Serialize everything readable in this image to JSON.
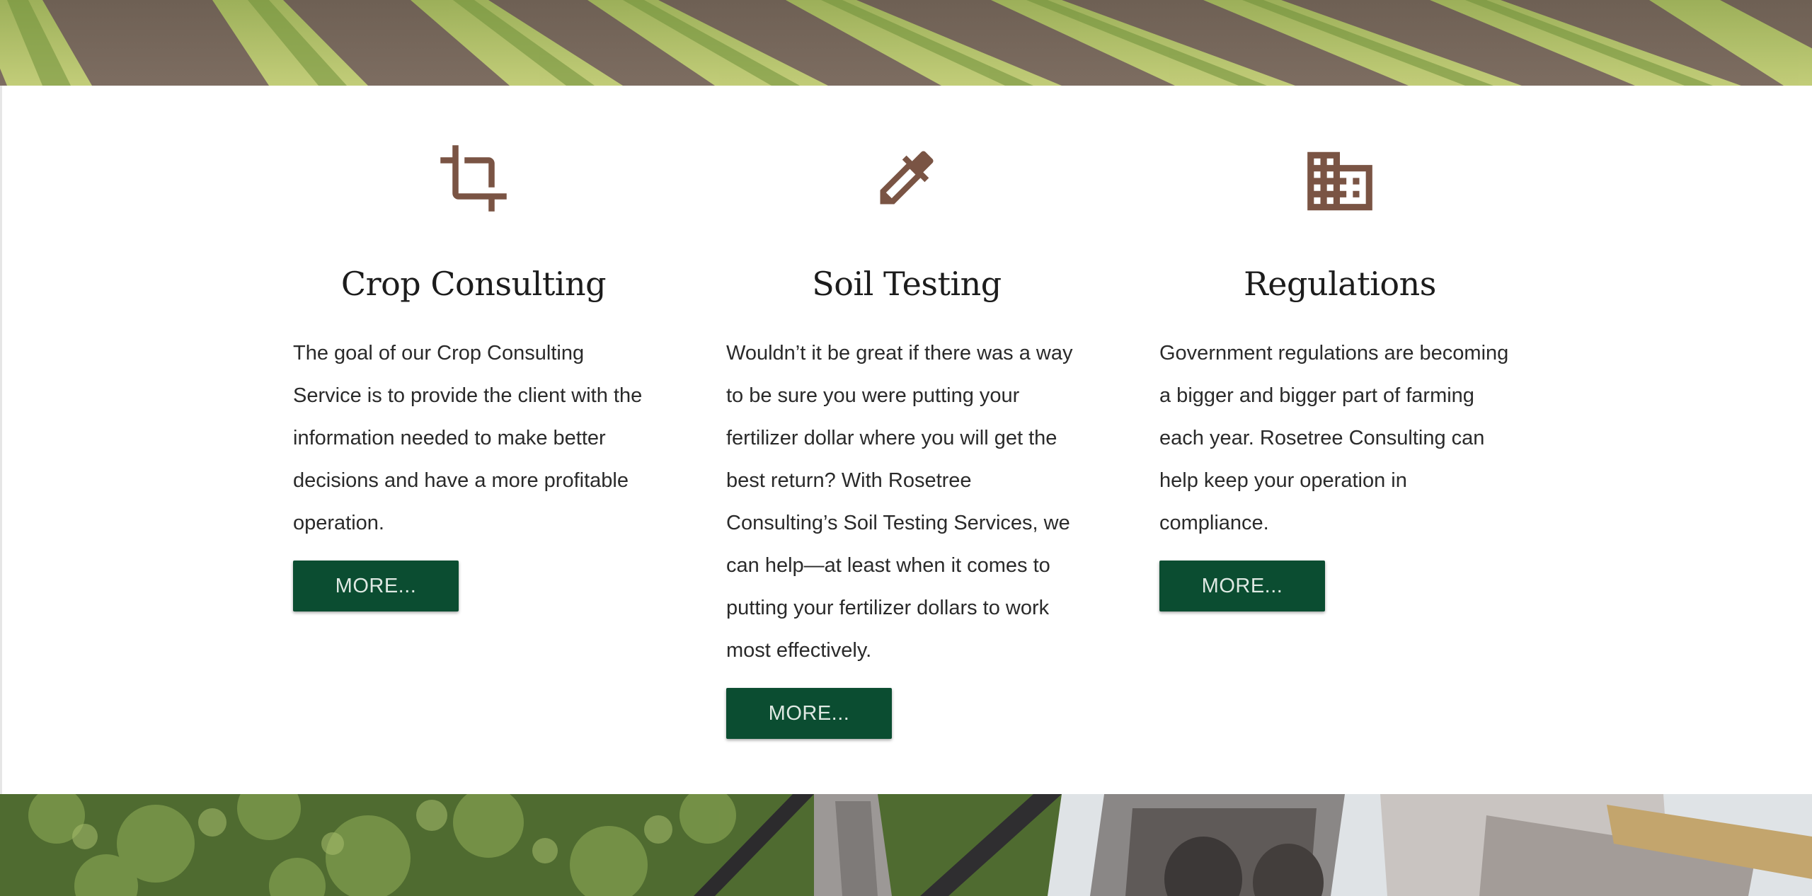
{
  "colors": {
    "icon": "#7a5444",
    "button_bg": "#0b4d31",
    "button_text": "#dfe9e3",
    "heading": "#1c1c1c",
    "body_text": "#2a2a2a"
  },
  "top_banner": {
    "image": "crop-field-rows-photo"
  },
  "services": [
    {
      "icon": "crop-icon",
      "title": "Crop Consulting",
      "text": "The goal of our Crop Consulting Service is to provide the client with the information needed to make better decisions and have a more profitable operation.",
      "button_label": "MORE..."
    },
    {
      "icon": "eyedropper-icon",
      "title": "Soil Testing",
      "text": "Wouldn’t it be great if there was a way to be sure you were putting your fertilizer dollar where you will get the best return? With Rosetree Consulting’s Soil Testing Services, we can help—at least when it comes to putting your fertilizer dollars to work most effectively.",
      "button_label": "MORE..."
    },
    {
      "icon": "building-icon",
      "title": "Regulations",
      "text": "Government regulations are becoming a bigger and bigger part of farming each year. Rosetree Consulting can help keep your operation in compliance.",
      "button_label": "MORE..."
    }
  ],
  "bottom_banner": {
    "image": "farm-machinery-photo"
  }
}
